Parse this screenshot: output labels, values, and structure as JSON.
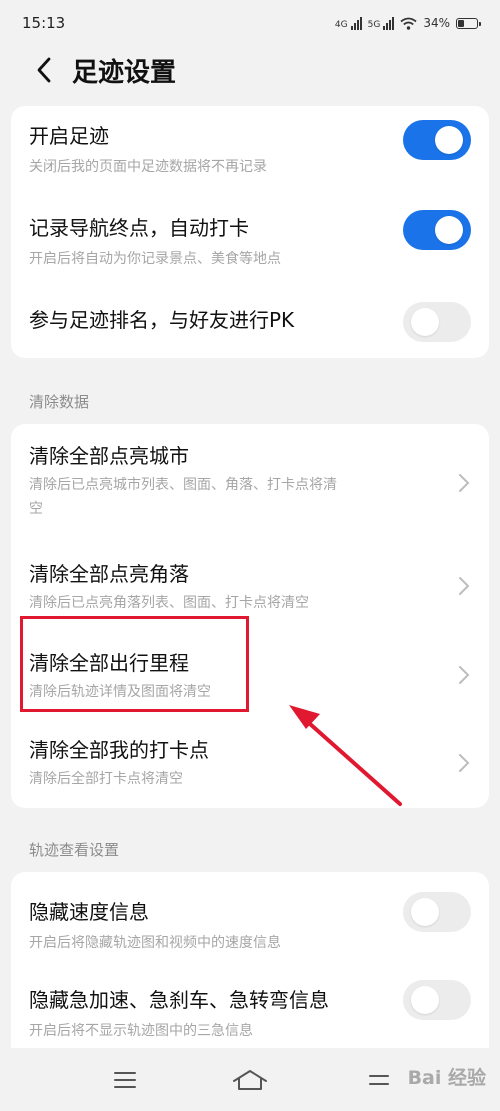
{
  "status": {
    "time": "15:13",
    "net1": "4G",
    "net2": "5G",
    "battery_text": "34%",
    "battery_level": 0.34
  },
  "header": {
    "title": "足迹设置"
  },
  "footprint": {
    "items": [
      {
        "title": "开启足迹",
        "subtitle": "关闭后我的页面中足迹数据将不再记录",
        "toggle": true
      },
      {
        "title": "记录导航终点，自动打卡",
        "subtitle": "开启后将自动为你记录景点、美食等地点",
        "toggle": true
      },
      {
        "title": "参与足迹排名，与好友进行PK",
        "toggle": false
      }
    ]
  },
  "clear_section": {
    "label": "清除数据",
    "items": [
      {
        "title": "清除全部点亮城市",
        "subtitle_line1": "清除后已点亮城市列表、图面、角落、打卡点将清",
        "subtitle_line2": "空"
      },
      {
        "title": "清除全部点亮角落",
        "subtitle": "清除后已点亮角落列表、图面、打卡点将清空"
      },
      {
        "title": "清除全部出行里程",
        "subtitle": "清除后轨迹详情及图面将清空"
      },
      {
        "title": "清除全部我的打卡点",
        "subtitle": "清除后全部打卡点将清空"
      }
    ]
  },
  "track_section": {
    "label": "轨迹查看设置",
    "items": [
      {
        "title": "隐藏速度信息",
        "subtitle": "开启后将隐藏轨迹图和视频中的速度信息",
        "toggle": false
      },
      {
        "title": "隐藏急加速、急刹车、急转弯信息",
        "subtitle": "开启后将不显示轨迹图中的三急信息",
        "toggle": false
      }
    ]
  },
  "annotation": {
    "color": "#e01830"
  },
  "colors": {
    "accent": "#1a73e8"
  },
  "watermark": {
    "text": "Bai 经验"
  }
}
